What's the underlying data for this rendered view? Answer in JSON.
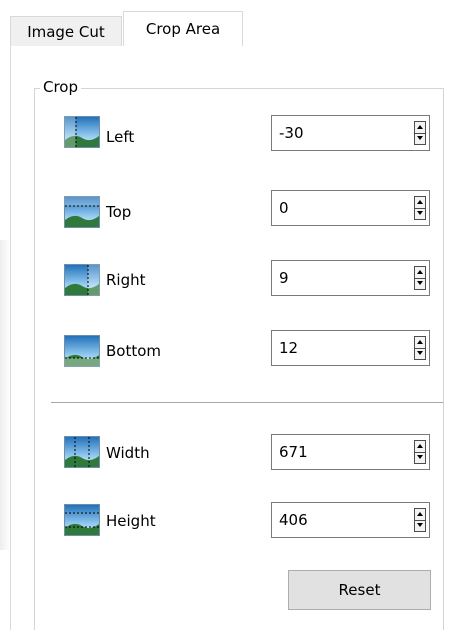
{
  "tabs": [
    {
      "label": "Image Cut",
      "active": false
    },
    {
      "label": "Crop Area",
      "active": true
    }
  ],
  "group": {
    "title": "Crop"
  },
  "fields": {
    "left": {
      "label": "Left",
      "value": "-30",
      "icon": "crop-left-icon"
    },
    "top": {
      "label": "Top",
      "value": "0",
      "icon": "crop-top-icon"
    },
    "right": {
      "label": "Right",
      "value": "9",
      "icon": "crop-right-icon"
    },
    "bottom": {
      "label": "Bottom",
      "value": "12",
      "icon": "crop-bottom-icon"
    },
    "width": {
      "label": "Width",
      "value": "671",
      "icon": "width-icon"
    },
    "height": {
      "label": "Height",
      "value": "406",
      "icon": "height-icon"
    }
  },
  "reset_label": "Reset",
  "colors": {
    "icon_sky": "#4a9fd8",
    "icon_land": "#2f7a3a",
    "border": "#7a7a7a",
    "button_bg": "#e1e1e1"
  }
}
